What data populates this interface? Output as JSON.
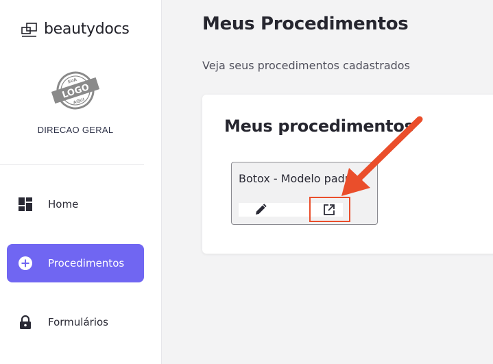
{
  "brand": {
    "name": "beautydocs"
  },
  "logo": {
    "top": "SUA",
    "middle": "LOGO",
    "bottom": "AQUI"
  },
  "company": {
    "name": "DIRECAO GERAL"
  },
  "nav": {
    "items": [
      {
        "label": "Home",
        "icon": "dashboard-icon",
        "active": false
      },
      {
        "label": "Procedimentos",
        "icon": "plus-circle-icon",
        "active": true
      },
      {
        "label": "Formulários",
        "icon": "lock-icon",
        "active": false
      }
    ]
  },
  "page": {
    "title": "Meus Procedimentos",
    "subtitle": "Veja seus procedimentos cadastrados"
  },
  "card": {
    "title": "Meus procedimentos",
    "procedures": [
      {
        "name": "Botox - Modelo padrão",
        "edit_icon": "pencil-icon",
        "open_icon": "external-link-icon"
      }
    ]
  },
  "colors": {
    "accent": "#7066f2",
    "highlight": "#ea4e2b"
  }
}
